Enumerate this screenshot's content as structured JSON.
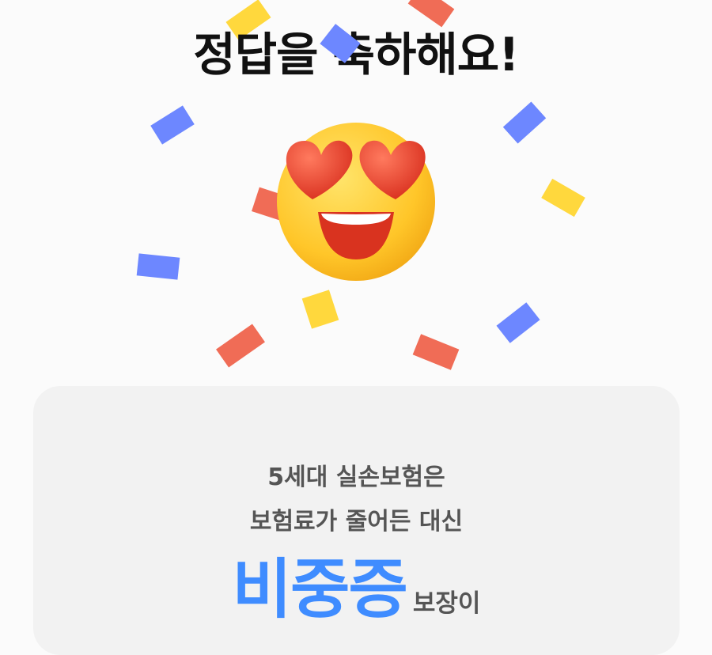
{
  "header": {
    "title": "정답을 축하해요!"
  },
  "visuals": {
    "emoji_icon": "heart-eyes-smiley-icon",
    "colors": {
      "blue": "#6d87ff",
      "yellow": "#ffd83d",
      "red": "#f06c56"
    }
  },
  "card": {
    "line1": "5세대 실손보험은",
    "line2": "보험료가 줄어든 대신",
    "highlight": "비중증",
    "highlight_suffix": "보장이"
  }
}
